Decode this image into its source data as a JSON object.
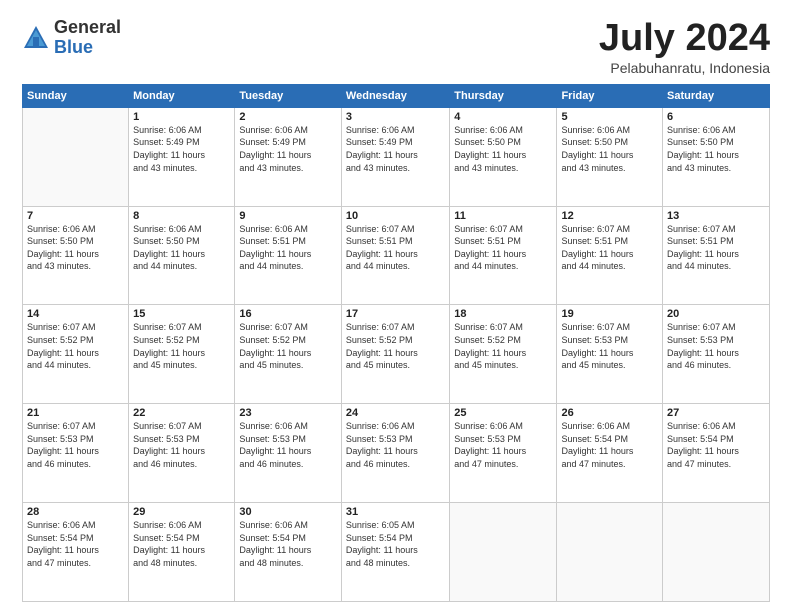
{
  "logo": {
    "general": "General",
    "blue": "Blue"
  },
  "header": {
    "month": "July 2024",
    "location": "Pelabuhanratu, Indonesia"
  },
  "days_of_week": [
    "Sunday",
    "Monday",
    "Tuesday",
    "Wednesday",
    "Thursday",
    "Friday",
    "Saturday"
  ],
  "weeks": [
    [
      {
        "day": "",
        "info": ""
      },
      {
        "day": "1",
        "info": "Sunrise: 6:06 AM\nSunset: 5:49 PM\nDaylight: 11 hours\nand 43 minutes."
      },
      {
        "day": "2",
        "info": "Sunrise: 6:06 AM\nSunset: 5:49 PM\nDaylight: 11 hours\nand 43 minutes."
      },
      {
        "day": "3",
        "info": "Sunrise: 6:06 AM\nSunset: 5:49 PM\nDaylight: 11 hours\nand 43 minutes."
      },
      {
        "day": "4",
        "info": "Sunrise: 6:06 AM\nSunset: 5:50 PM\nDaylight: 11 hours\nand 43 minutes."
      },
      {
        "day": "5",
        "info": "Sunrise: 6:06 AM\nSunset: 5:50 PM\nDaylight: 11 hours\nand 43 minutes."
      },
      {
        "day": "6",
        "info": "Sunrise: 6:06 AM\nSunset: 5:50 PM\nDaylight: 11 hours\nand 43 minutes."
      }
    ],
    [
      {
        "day": "7",
        "info": "Sunrise: 6:06 AM\nSunset: 5:50 PM\nDaylight: 11 hours\nand 43 minutes."
      },
      {
        "day": "8",
        "info": "Sunrise: 6:06 AM\nSunset: 5:50 PM\nDaylight: 11 hours\nand 44 minutes."
      },
      {
        "day": "9",
        "info": "Sunrise: 6:06 AM\nSunset: 5:51 PM\nDaylight: 11 hours\nand 44 minutes."
      },
      {
        "day": "10",
        "info": "Sunrise: 6:07 AM\nSunset: 5:51 PM\nDaylight: 11 hours\nand 44 minutes."
      },
      {
        "day": "11",
        "info": "Sunrise: 6:07 AM\nSunset: 5:51 PM\nDaylight: 11 hours\nand 44 minutes."
      },
      {
        "day": "12",
        "info": "Sunrise: 6:07 AM\nSunset: 5:51 PM\nDaylight: 11 hours\nand 44 minutes."
      },
      {
        "day": "13",
        "info": "Sunrise: 6:07 AM\nSunset: 5:51 PM\nDaylight: 11 hours\nand 44 minutes."
      }
    ],
    [
      {
        "day": "14",
        "info": "Sunrise: 6:07 AM\nSunset: 5:52 PM\nDaylight: 11 hours\nand 44 minutes."
      },
      {
        "day": "15",
        "info": "Sunrise: 6:07 AM\nSunset: 5:52 PM\nDaylight: 11 hours\nand 45 minutes."
      },
      {
        "day": "16",
        "info": "Sunrise: 6:07 AM\nSunset: 5:52 PM\nDaylight: 11 hours\nand 45 minutes."
      },
      {
        "day": "17",
        "info": "Sunrise: 6:07 AM\nSunset: 5:52 PM\nDaylight: 11 hours\nand 45 minutes."
      },
      {
        "day": "18",
        "info": "Sunrise: 6:07 AM\nSunset: 5:52 PM\nDaylight: 11 hours\nand 45 minutes."
      },
      {
        "day": "19",
        "info": "Sunrise: 6:07 AM\nSunset: 5:53 PM\nDaylight: 11 hours\nand 45 minutes."
      },
      {
        "day": "20",
        "info": "Sunrise: 6:07 AM\nSunset: 5:53 PM\nDaylight: 11 hours\nand 46 minutes."
      }
    ],
    [
      {
        "day": "21",
        "info": "Sunrise: 6:07 AM\nSunset: 5:53 PM\nDaylight: 11 hours\nand 46 minutes."
      },
      {
        "day": "22",
        "info": "Sunrise: 6:07 AM\nSunset: 5:53 PM\nDaylight: 11 hours\nand 46 minutes."
      },
      {
        "day": "23",
        "info": "Sunrise: 6:06 AM\nSunset: 5:53 PM\nDaylight: 11 hours\nand 46 minutes."
      },
      {
        "day": "24",
        "info": "Sunrise: 6:06 AM\nSunset: 5:53 PM\nDaylight: 11 hours\nand 46 minutes."
      },
      {
        "day": "25",
        "info": "Sunrise: 6:06 AM\nSunset: 5:53 PM\nDaylight: 11 hours\nand 47 minutes."
      },
      {
        "day": "26",
        "info": "Sunrise: 6:06 AM\nSunset: 5:54 PM\nDaylight: 11 hours\nand 47 minutes."
      },
      {
        "day": "27",
        "info": "Sunrise: 6:06 AM\nSunset: 5:54 PM\nDaylight: 11 hours\nand 47 minutes."
      }
    ],
    [
      {
        "day": "28",
        "info": "Sunrise: 6:06 AM\nSunset: 5:54 PM\nDaylight: 11 hours\nand 47 minutes."
      },
      {
        "day": "29",
        "info": "Sunrise: 6:06 AM\nSunset: 5:54 PM\nDaylight: 11 hours\nand 48 minutes."
      },
      {
        "day": "30",
        "info": "Sunrise: 6:06 AM\nSunset: 5:54 PM\nDaylight: 11 hours\nand 48 minutes."
      },
      {
        "day": "31",
        "info": "Sunrise: 6:05 AM\nSunset: 5:54 PM\nDaylight: 11 hours\nand 48 minutes."
      },
      {
        "day": "",
        "info": ""
      },
      {
        "day": "",
        "info": ""
      },
      {
        "day": "",
        "info": ""
      }
    ]
  ]
}
